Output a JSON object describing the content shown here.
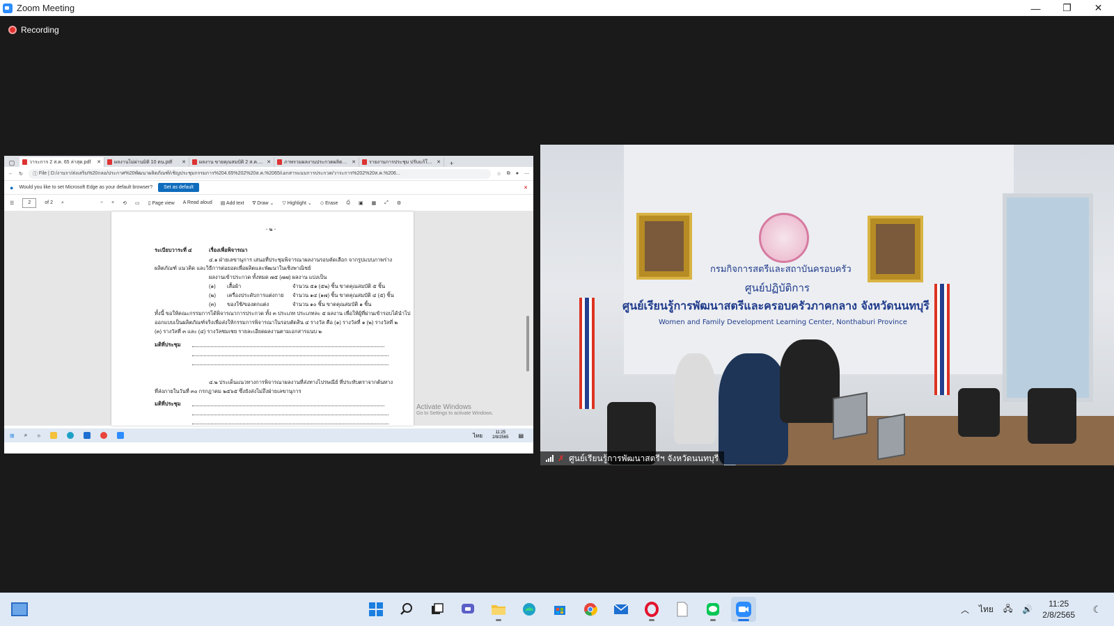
{
  "window": {
    "title": "Zoom Meeting",
    "minimize": "—",
    "restore": "❐",
    "close": "✕"
  },
  "recording": {
    "label": "Recording"
  },
  "share": {
    "tabs": [
      {
        "label": "วาระการ 2 ส.ค. 65 ล่าสุด.pdf",
        "close": "✕"
      },
      {
        "label": "ผลงานไม่ผ่านมิติ 10 ตน.pdf",
        "close": "✕"
      },
      {
        "label": "ผลงาน ขายคุณสมบัติ 2 ส.ค.pdf",
        "close": "✕"
      },
      {
        "label": "ภาพรวมผลงานประกวดผลิตภัณฑ์ 2",
        "close": "✕"
      },
      {
        "label": "รายงานการประชุม ปรับแก้ใน.pdf",
        "close": "✕"
      }
    ],
    "new_tab": "+",
    "address": {
      "scheme": "File",
      "url": "D:/งานรา/ส่งเสริม%20กลอ/ประกาศ%20พัฒนาผลิตภัณฑ์/เชิญประชุมกรรมการ%204.65%202%20ส.ค.%2065/เอกสารแนบการประกวด/วาระการ%202%20ส.ค.%206..."
    },
    "edge_prompt": {
      "text": "Would you like to set Microsoft Edge as your default browser?",
      "button": "Set as default"
    },
    "pdf_toolbar": {
      "page": "2",
      "of": "of 2",
      "page_view": "Page view",
      "read_aloud": "Read aloud",
      "add_text": "Add text",
      "draw": "Draw",
      "highlight": "Highlight",
      "erase": "Erase"
    },
    "doc": {
      "page_num": "- ๒ -",
      "agenda_no": "ระเบียบวาระที่ ๔",
      "agenda_title": "เรื่องเพื่อพิจารณา",
      "l1": "๔.๑ ฝ่ายเลขานุการ เสนอที่ประชุมพิจารณาผลงานรอบคัดเลือก จากรูปแบบภาพร่าง",
      "l2": "ผลิตภัณฑ์ แนวคิด และวิธีการต่อยอดเพื่อผลิตและพัฒนาในเชิงพาณิชย์",
      "l3": "ผลงานเข้าประกวด ทั้งหมด ๗๕ (๗๗) ผลงาน แบ่งเป็น",
      "rows": [
        {
          "no": "(๑)",
          "name": "เสื้อผ้า",
          "detail": "จำนวน ๕๑ (๕๒) ชิ้น ขาดคุณสมบัติ ๕ ชิ้น"
        },
        {
          "no": "(๒)",
          "name": "เครื่องประดับการแต่งกาย",
          "detail": "จำนวน ๑๔ (๑๗) ชิ้น ขาดคุณสมบัติ ๔ (๕) ชิ้น"
        },
        {
          "no": "(๓)",
          "name": "ของใช้/ของตกแต่ง",
          "detail": "จำนวน ๑๐ ชิ้น ขาดคุณสมบัติ ๑ ชิ้น"
        }
      ],
      "l4": "ทั้งนี้ ขอให้คณะกรรมการได้พิจารณาการประกวด ทั้ง ๓ ประเภท ประเภทละ ๕ ผลงาน เพื่อให้ผู้ที่ผ่านเข้ารอบได้นำไป",
      "l5": "ออกแบบเป็นผลิตภัณฑ์จริงเพื่อส่งให้กรรมการพิจารณาในรอบตัดสิน ๔ รางวัล คือ (๑) รางวัลที่ ๑ (๒) รางวัลที่ ๒",
      "l6": "(๓) รางวัลที่ ๓ และ (๔) รางวัลชมเชย รายละเอียดผลงานตามเอกสารแนบ ๒",
      "resolution": "มติที่ประชุม",
      "l7": "๔.๒ ประเด็นแนวทางการพิจารณาผลงานที่ส่งทางไปรษณีย์ ที่ประทับตราจากต้นทาง",
      "l8": "ที่ส่งภายในวันที่ ๓๐ กรกฎาคม ๒๕๖๕ ซึ่งยังส่งไม่ถึงฝ่ายเลขานุการ",
      "resolution2": "มติที่ประชุม"
    },
    "activate": {
      "title": "Activate Windows",
      "sub": "Go to Settings to activate Windows."
    },
    "mini_taskbar": {
      "time": "11:25",
      "date": "2/8/2565",
      "lang": "ไทย"
    }
  },
  "video": {
    "sign": {
      "line1": "กรมกิจการสตรีและสถาบันครอบครัว",
      "line2": "ศูนย์ปฏิบัติการ",
      "line3": "ศูนย์เรียนรู้การพัฒนาสตรีและครอบครัวภาคกลาง จังหวัดนนทบุรี",
      "line4": "Women and Family Development Learning Center, Nonthaburi Province"
    },
    "participant": "ศูนย์เรียนรู้การพัฒนาสตรีฯ จังหวัดนนทบุรี"
  },
  "taskbar": {
    "lang": "ไทย",
    "time": "11:25",
    "date": "2/8/2565",
    "icons": [
      "start-icon",
      "search-icon",
      "task-view-icon",
      "teams-chat-icon",
      "file-explorer-icon",
      "edge-icon",
      "store-icon",
      "chrome-icon",
      "mail-icon",
      "opera-icon",
      "notepad-icon",
      "line-icon",
      "zoom-icon"
    ]
  },
  "colors": {
    "zoom_blue": "#2d8cff",
    "recording_red": "#e0312e",
    "edge_blue": "#0f6cbd",
    "taskbar_bg": "#dfe9f5"
  }
}
